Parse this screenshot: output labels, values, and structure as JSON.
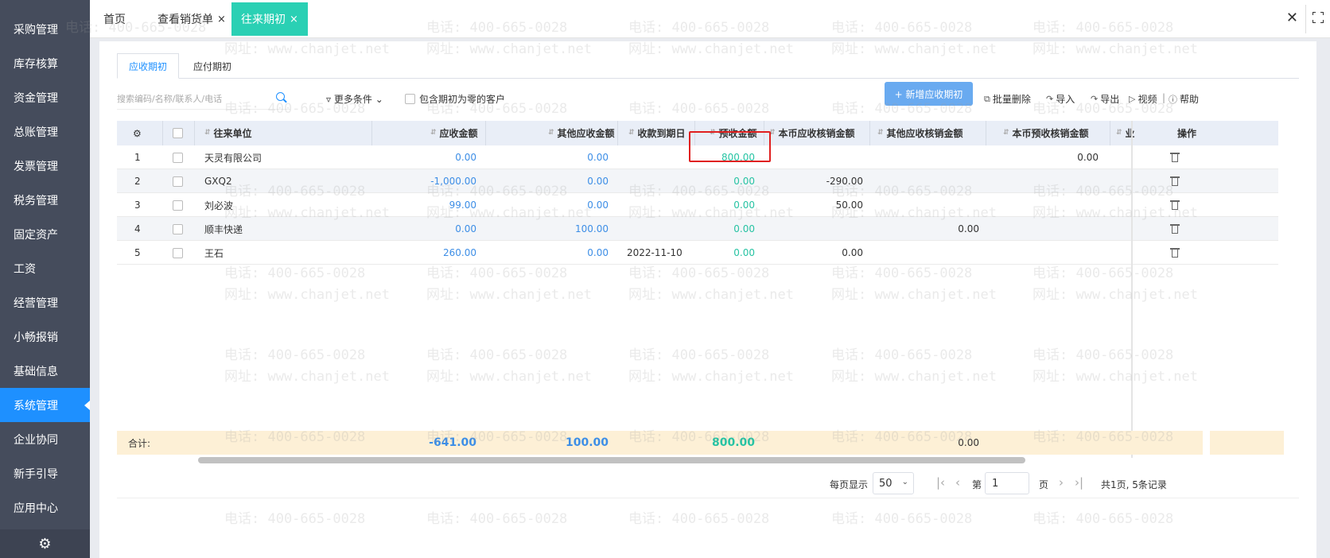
{
  "sidebar": {
    "items": [
      {
        "label": "采购管理"
      },
      {
        "label": "库存核算"
      },
      {
        "label": "资金管理"
      },
      {
        "label": "总账管理"
      },
      {
        "label": "发票管理"
      },
      {
        "label": "税务管理"
      },
      {
        "label": "固定资产"
      },
      {
        "label": "工资"
      },
      {
        "label": "经营管理"
      },
      {
        "label": "小畅报销"
      },
      {
        "label": "基础信息"
      },
      {
        "label": "系统管理"
      },
      {
        "label": "企业协同"
      },
      {
        "label": "新手引导"
      },
      {
        "label": "应用中心"
      }
    ],
    "active_index": 11,
    "settings_icon": "gear-icon"
  },
  "tabs": {
    "home": "首页",
    "sales": "查看销货单",
    "active": "往来期初",
    "close_glyph": "×"
  },
  "subtabs": {
    "receivable": "应收期初",
    "payable": "应付期初"
  },
  "toolbar": {
    "search_placeholder": "搜索编码/名称/联系人/电话",
    "more_filters": "更多条件",
    "include_zero": "包含期初为零的客户",
    "add_button": "+ 新增应收期初",
    "batch_delete": "批量删除",
    "import": "导入",
    "export": "导出",
    "video": "视频",
    "help": "帮助",
    "divider": "|"
  },
  "table": {
    "columns": {
      "unit": "往来单位",
      "receivable": "应收金额",
      "other_receivable": "其他应收金额",
      "due_date": "收款到期日",
      "advance": "预收金额",
      "local_write_off": "本币应收核销金额",
      "other_write_off": "其他应收核销金额",
      "local_advance_write_off": "本币预收核销金额",
      "more": "业",
      "action": "操作"
    },
    "rows": [
      {
        "no": "1",
        "unit": "天灵有限公司",
        "receivable": "0.00",
        "other_receivable": "0.00",
        "due_date": "",
        "advance": "800.00",
        "local_write_off": "",
        "other_write_off": "",
        "local_advance_write_off": "0.00"
      },
      {
        "no": "2",
        "unit": "GXQ2",
        "receivable": "-1,000.00",
        "other_receivable": "0.00",
        "due_date": "",
        "advance": "0.00",
        "local_write_off": "-290.00",
        "other_write_off": "",
        "local_advance_write_off": ""
      },
      {
        "no": "3",
        "unit": "刘必波",
        "receivable": "99.00",
        "other_receivable": "0.00",
        "due_date": "",
        "advance": "0.00",
        "local_write_off": "50.00",
        "other_write_off": "",
        "local_advance_write_off": ""
      },
      {
        "no": "4",
        "unit": "顺丰快递",
        "receivable": "0.00",
        "other_receivable": "100.00",
        "due_date": "",
        "advance": "0.00",
        "local_write_off": "",
        "other_write_off": "0.00",
        "local_advance_write_off": ""
      },
      {
        "no": "5",
        "unit": "王石",
        "receivable": "260.00",
        "other_receivable": "0.00",
        "due_date": "2022-11-10",
        "advance": "0.00",
        "local_write_off": "0.00",
        "other_write_off": "",
        "local_advance_write_off": ""
      }
    ],
    "totals": {
      "label": "合计:",
      "receivable": "-641.00",
      "other_receivable": "100.00",
      "advance": "800.00",
      "other_write_off": "0.00"
    }
  },
  "pager": {
    "per_page_label": "每页显示",
    "per_page": "50",
    "page_prefix": "第",
    "page": "1",
    "page_suffix": "页",
    "summary": "共1页, 5条记录"
  },
  "watermark": {
    "phone": "电话: 400-665-0028",
    "site": "网址: www.chanjet.net"
  },
  "colors": {
    "sidebar_bg": "#454c5c",
    "active_blue": "#1e90ff",
    "tab_active": "#2ad0b4",
    "primary_button": "#69aaf0",
    "amount_blue": "#3d8ee6",
    "amount_green": "#27c3a3",
    "highlight_red": "#e02020",
    "total_row_bg": "#fdf0d6"
  }
}
